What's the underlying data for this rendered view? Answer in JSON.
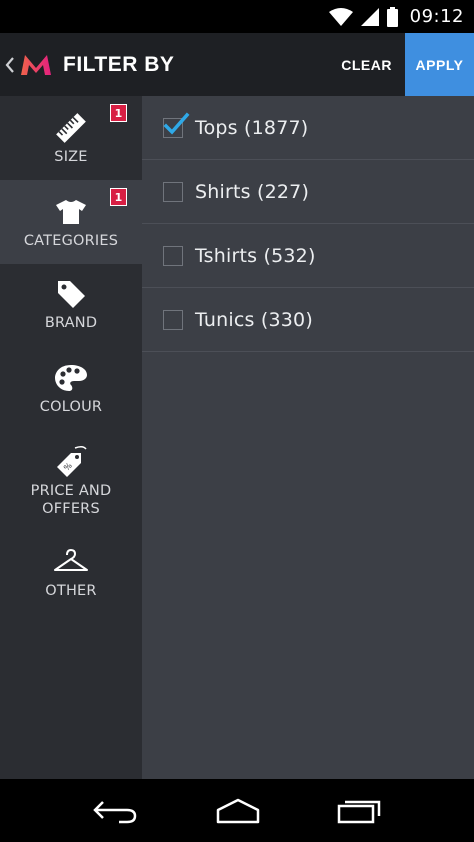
{
  "status_bar": {
    "time": "09:12"
  },
  "header": {
    "title": "FILTER BY",
    "clear_label": "CLEAR",
    "apply_label": "APPLY",
    "logo_letter": "M"
  },
  "sidebar": {
    "items": [
      {
        "label": "SIZE",
        "icon": "ruler-icon",
        "badge": "1",
        "active": false
      },
      {
        "label": "CATEGORIES",
        "icon": "tshirt-icon",
        "badge": "1",
        "active": true
      },
      {
        "label": "BRAND",
        "icon": "tag-icon",
        "badge": null,
        "active": false
      },
      {
        "label": "COLOUR",
        "icon": "palette-icon",
        "badge": null,
        "active": false
      },
      {
        "label": "PRICE AND OFFERS",
        "icon": "price-tag-icon",
        "badge": null,
        "active": false
      },
      {
        "label": "OTHER",
        "icon": "hanger-icon",
        "badge": null,
        "active": false
      }
    ]
  },
  "options": [
    {
      "label": "Tops (1877)",
      "checked": true
    },
    {
      "label": "Shirts (227)",
      "checked": false
    },
    {
      "label": "Tshirts (532)",
      "checked": false
    },
    {
      "label": "Tunics (330)",
      "checked": false
    }
  ],
  "colors": {
    "accent": "#3f8fe0",
    "badge": "#d81f44",
    "check": "#2fa9e8"
  }
}
